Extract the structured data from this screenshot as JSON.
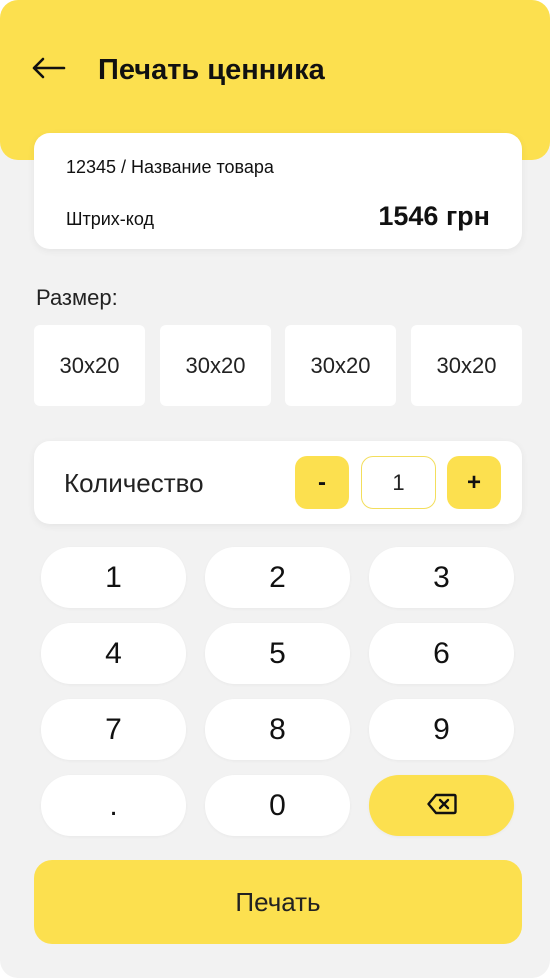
{
  "header": {
    "title": "Печать ценника",
    "back_icon": "arrow-left-icon"
  },
  "product": {
    "name": "12345 / Название товара",
    "barcode_label": "Штрих-код",
    "price": "1546 грн"
  },
  "size": {
    "label": "Размер:",
    "options": [
      "30x20",
      "30x20",
      "30x20",
      "30x20"
    ]
  },
  "quantity": {
    "label": "Количество",
    "minus": "-",
    "value": "1",
    "plus": "+"
  },
  "keypad": {
    "keys": [
      "1",
      "2",
      "3",
      "4",
      "5",
      "6",
      "7",
      "8",
      "9",
      ".",
      "0"
    ],
    "backspace_icon": "backspace-icon"
  },
  "print_button": "Печать",
  "colors": {
    "accent": "#fce04f",
    "background": "#f2f2f2",
    "card": "#ffffff"
  }
}
